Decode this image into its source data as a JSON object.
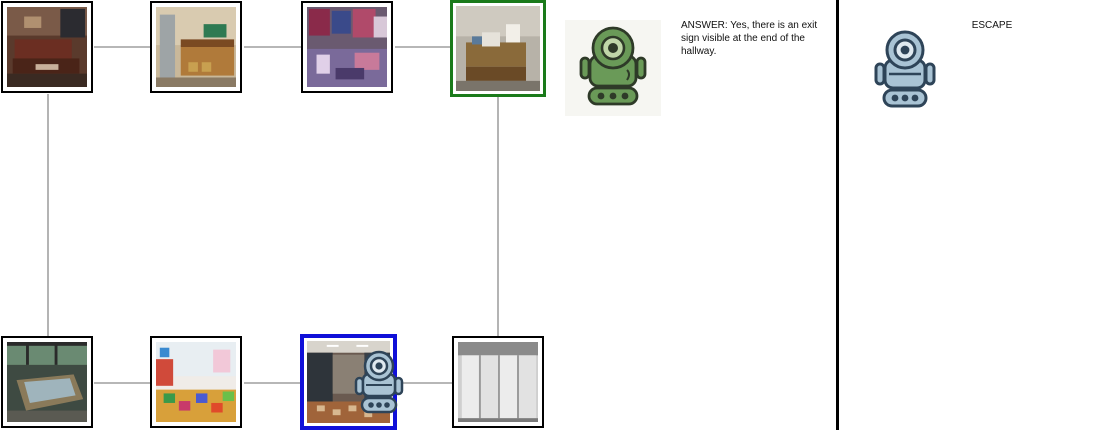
{
  "answer": {
    "text": "ANSWER: Yes, there is an exit sign visible at the end of the hallway."
  },
  "action": {
    "text": "ESCAPE"
  },
  "map": {
    "rooms": [
      {
        "id": "living-room",
        "scene": "living-room"
      },
      {
        "id": "kitchen",
        "scene": "kitchen"
      },
      {
        "id": "art-studio",
        "scene": "art-studio"
      },
      {
        "id": "office-desk",
        "scene": "office-desk",
        "status": "goal"
      },
      {
        "id": "hot-tub",
        "scene": "hot-tub"
      },
      {
        "id": "playroom",
        "scene": "playroom"
      },
      {
        "id": "locker-hallway",
        "scene": "locker-hallway",
        "status": "current"
      },
      {
        "id": "storage-shelves",
        "scene": "storage-shelves"
      }
    ]
  },
  "colors": {
    "goal_border": "#1a7a1a",
    "current_border": "#1010d8",
    "edge": "#8c8c8c",
    "divider": "#000000",
    "robot_green": "#6a9a58",
    "robot_blue": "#a9c3d4"
  },
  "icons": [
    "green-robot-icon",
    "blue-robot-icon"
  ]
}
